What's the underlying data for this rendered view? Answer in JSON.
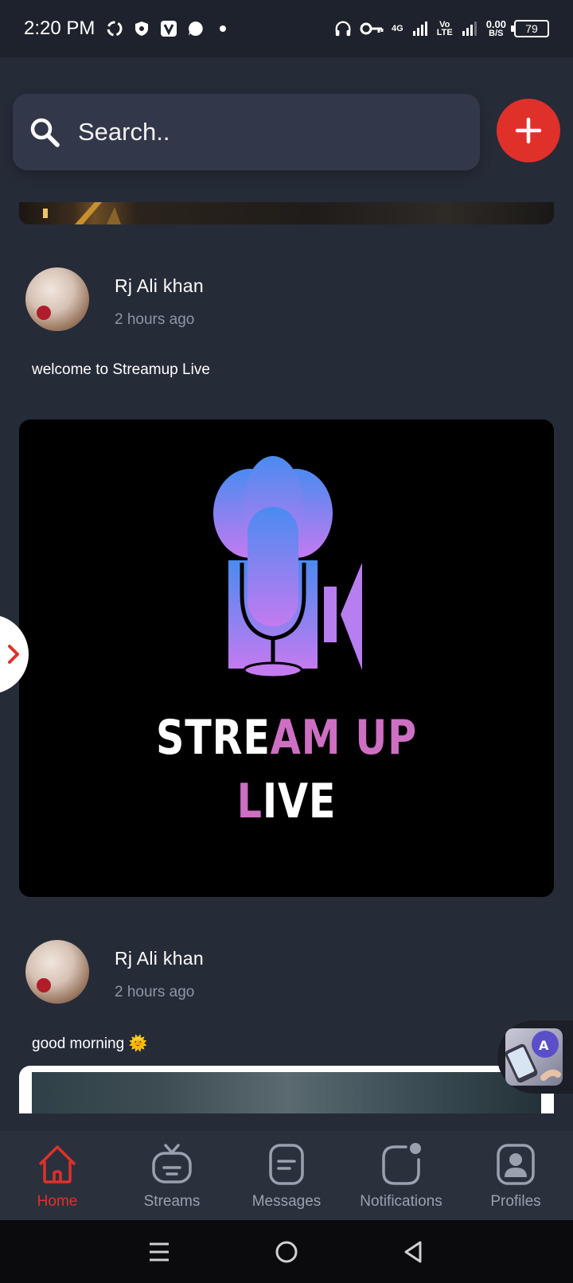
{
  "status_bar": {
    "time": "2:20 PM",
    "net_speed_value": "0.00",
    "net_speed_unit": "B/S",
    "network_type": "4G",
    "volte_top": "Vo",
    "volte_bottom": "LTE",
    "battery": "79"
  },
  "search": {
    "placeholder": "Search.."
  },
  "posts": [
    {
      "author": "Rj Ali khan",
      "time": "2 hours ago",
      "text": "welcome to Streamup Live",
      "image_logo_line1_white": "STRE",
      "image_logo_line1_pink": "AM UP",
      "image_logo_line2_pink": "L",
      "image_logo_line2_white": "IVE"
    },
    {
      "author": "Rj Ali khan",
      "time": "2 hours ago",
      "text": "good morning 🌞"
    }
  ],
  "bottom_nav": {
    "items": [
      {
        "label": "Home",
        "icon": "home-icon",
        "active": true
      },
      {
        "label": "Streams",
        "icon": "tv-icon",
        "active": false
      },
      {
        "label": "Messages",
        "icon": "message-icon",
        "active": false
      },
      {
        "label": "Notifications",
        "icon": "notification-icon",
        "active": false
      },
      {
        "label": "Profiles",
        "icon": "profile-icon",
        "active": false
      }
    ]
  },
  "colors": {
    "background": "#262b38",
    "accent": "#e0302a",
    "nav_inactive": "#9aa0ad",
    "logo_pink": "#cd6fc3"
  }
}
